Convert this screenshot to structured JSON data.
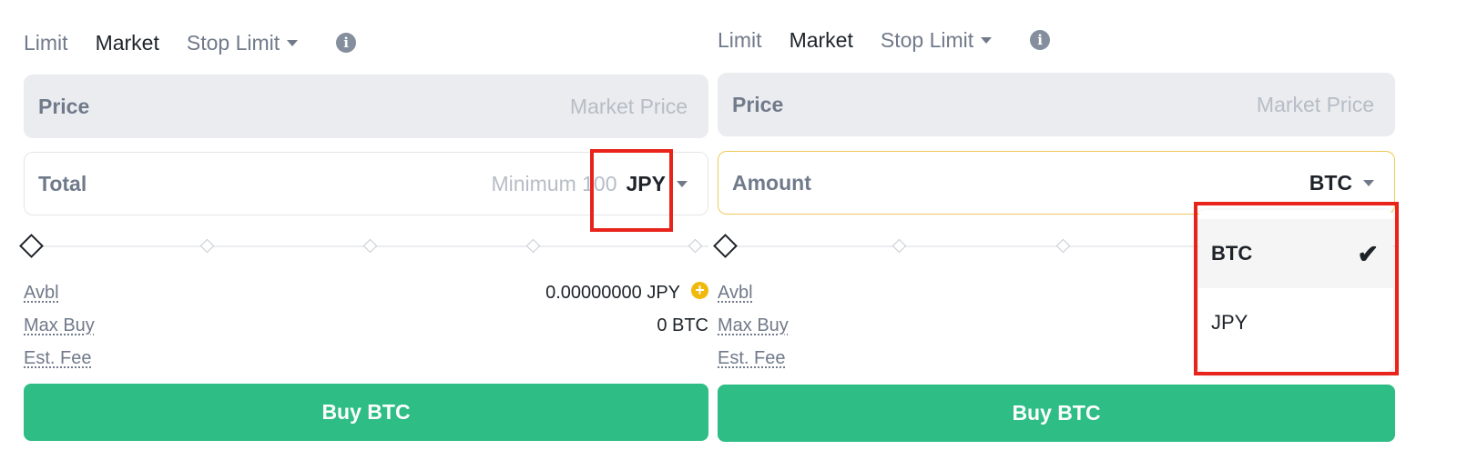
{
  "left": {
    "tabs": {
      "limit": "Limit",
      "market": "Market",
      "stop_limit": "Stop Limit"
    },
    "price": {
      "label": "Price",
      "placeholder": "Market Price"
    },
    "total": {
      "label": "Total",
      "placeholder": "Minimum 100",
      "unit": "JPY"
    },
    "avbl": {
      "label": "Avbl",
      "value": "0.00000000 JPY"
    },
    "max_buy": {
      "label": "Max Buy",
      "value": "0 BTC"
    },
    "est_fee": {
      "label": "Est. Fee"
    },
    "buy_label": "Buy BTC"
  },
  "right": {
    "tabs": {
      "limit": "Limit",
      "market": "Market",
      "stop_limit": "Stop Limit"
    },
    "price": {
      "label": "Price",
      "placeholder": "Market Price"
    },
    "amount": {
      "label": "Amount",
      "unit": "BTC"
    },
    "avbl": {
      "label": "Avbl"
    },
    "max_buy": {
      "label": "Max Buy"
    },
    "est_fee": {
      "label": "Est. Fee"
    },
    "buy_label": "Buy BTC",
    "dropdown": {
      "options": [
        "BTC",
        "JPY"
      ],
      "selected": "BTC"
    }
  },
  "icons": {
    "info": "info-icon",
    "plus": "plus-circle-icon",
    "check": "check-icon",
    "caret": "caret-down-icon"
  },
  "colors": {
    "buy_green": "#2ebd85",
    "highlight_red": "#e8231b",
    "focus_yellow": "#f0c95a",
    "accent_yellow": "#f0b90b"
  }
}
